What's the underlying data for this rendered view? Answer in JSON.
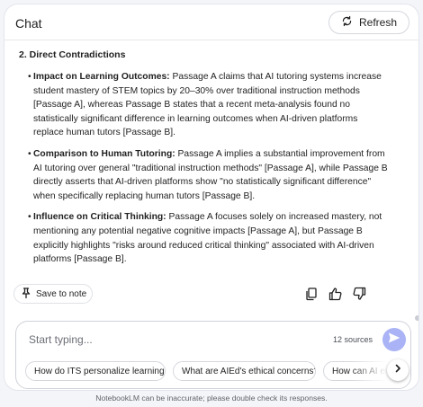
{
  "header": {
    "title": "Chat",
    "refresh_label": "Refresh"
  },
  "content": {
    "section_title": "2. Direct Contradictions",
    "bullets": [
      {
        "label": "Impact on Learning Outcomes:",
        "text": " Passage A claims that AI tutoring systems increase student mastery of STEM topics by 20–30% over traditional instruction methods [Passage A], whereas Passage B states that a recent meta-analysis found no statistically significant difference in learning outcomes when AI-driven platforms replace human tutors [Passage B]."
      },
      {
        "label": "Comparison to Human Tutoring:",
        "text": " Passage A implies a substantial improvement from AI tutoring over general \"traditional instruction methods\" [Passage A], while Passage B directly asserts that AI-driven platforms show \"no statistically significant difference\" when specifically replacing human tutors [Passage B]."
      },
      {
        "label": "Influence on Critical Thinking:",
        "text": " Passage A focuses solely on increased mastery, not mentioning any potential negative cognitive impacts [Passage A], but Passage B explicitly highlights \"risks around reduced critical thinking\" associated with AI-driven platforms [Passage B]."
      }
    ]
  },
  "actions": {
    "save_note_label": "Save to note"
  },
  "composer": {
    "placeholder": "Start typing...",
    "sources_label": "12 sources",
    "suggestions": [
      "How do ITS personalize learning?",
      "What are AIEd's ethical concerns?",
      "How can AI enhance"
    ]
  },
  "disclaimer": "NotebookLM can be inaccurate; please double check its responses.",
  "colors": {
    "send_button": "#a9b3f5",
    "panel_bg": "#ffffff",
    "page_bg": "#f4f5f9"
  }
}
